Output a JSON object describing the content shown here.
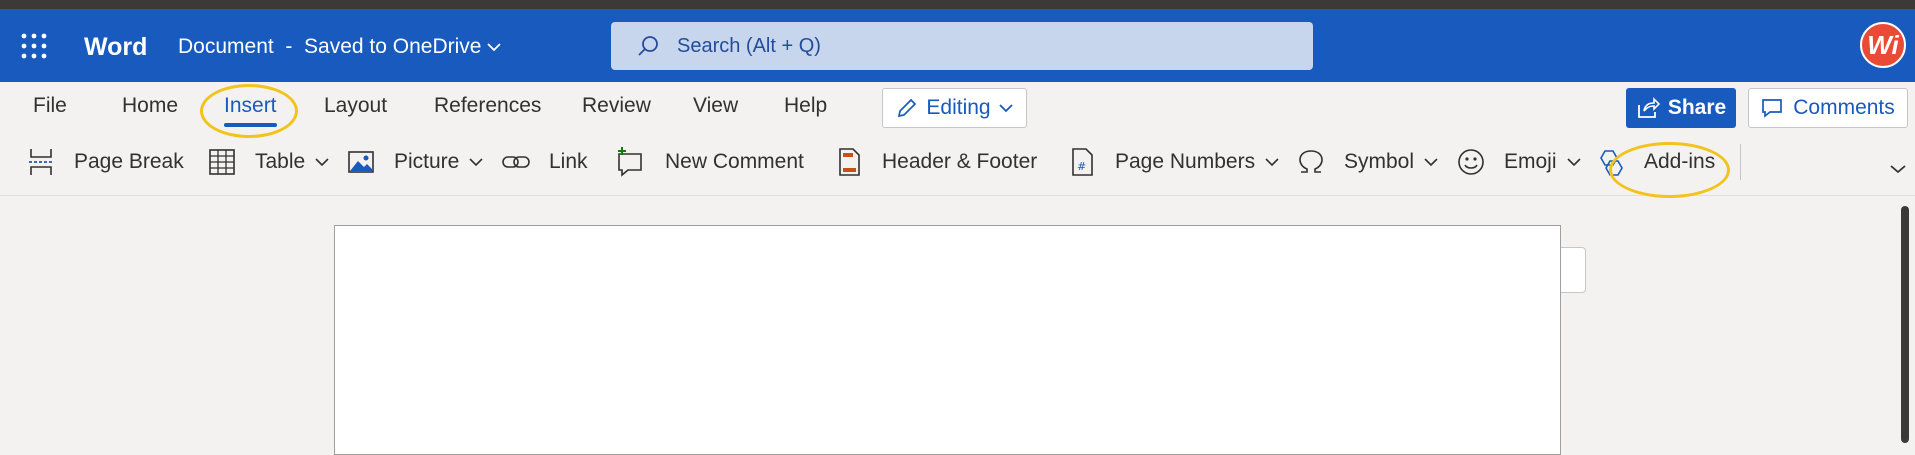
{
  "titlebar": {
    "app_name": "Word",
    "doc_title": "Document  -  Saved to OneDrive",
    "search_placeholder": "Search (Alt + Q)",
    "avatar_initials": "Wi"
  },
  "tabs": [
    {
      "label": "File"
    },
    {
      "label": "Home"
    },
    {
      "label": "Insert",
      "active": true
    },
    {
      "label": "Layout"
    },
    {
      "label": "References"
    },
    {
      "label": "Review"
    },
    {
      "label": "View"
    },
    {
      "label": "Help"
    }
  ],
  "mode": {
    "label": "Editing"
  },
  "actions": {
    "share_label": "Share",
    "comments_label": "Comments"
  },
  "ribbon": [
    {
      "label": "Page Break",
      "icon": "page-break-icon",
      "dropdown": false
    },
    {
      "label": "Table",
      "icon": "table-icon",
      "dropdown": true
    },
    {
      "label": "Picture",
      "icon": "picture-icon",
      "dropdown": true
    },
    {
      "label": "Link",
      "icon": "link-icon",
      "dropdown": false
    },
    {
      "label": "New Comment",
      "icon": "new-comment-icon",
      "dropdown": false
    },
    {
      "label": "Header & Footer",
      "icon": "header-footer-icon",
      "dropdown": false
    },
    {
      "label": "Page Numbers",
      "icon": "page-numbers-icon",
      "dropdown": true
    },
    {
      "label": "Symbol",
      "icon": "omega-icon",
      "dropdown": true
    },
    {
      "label": "Emoji",
      "icon": "emoji-icon",
      "dropdown": true
    },
    {
      "label": "Add-ins",
      "icon": "add-ins-icon",
      "dropdown": false
    }
  ],
  "colors": {
    "brand": "#185abd",
    "highlight": "#f2c31b",
    "avatar": "#e94b36"
  }
}
